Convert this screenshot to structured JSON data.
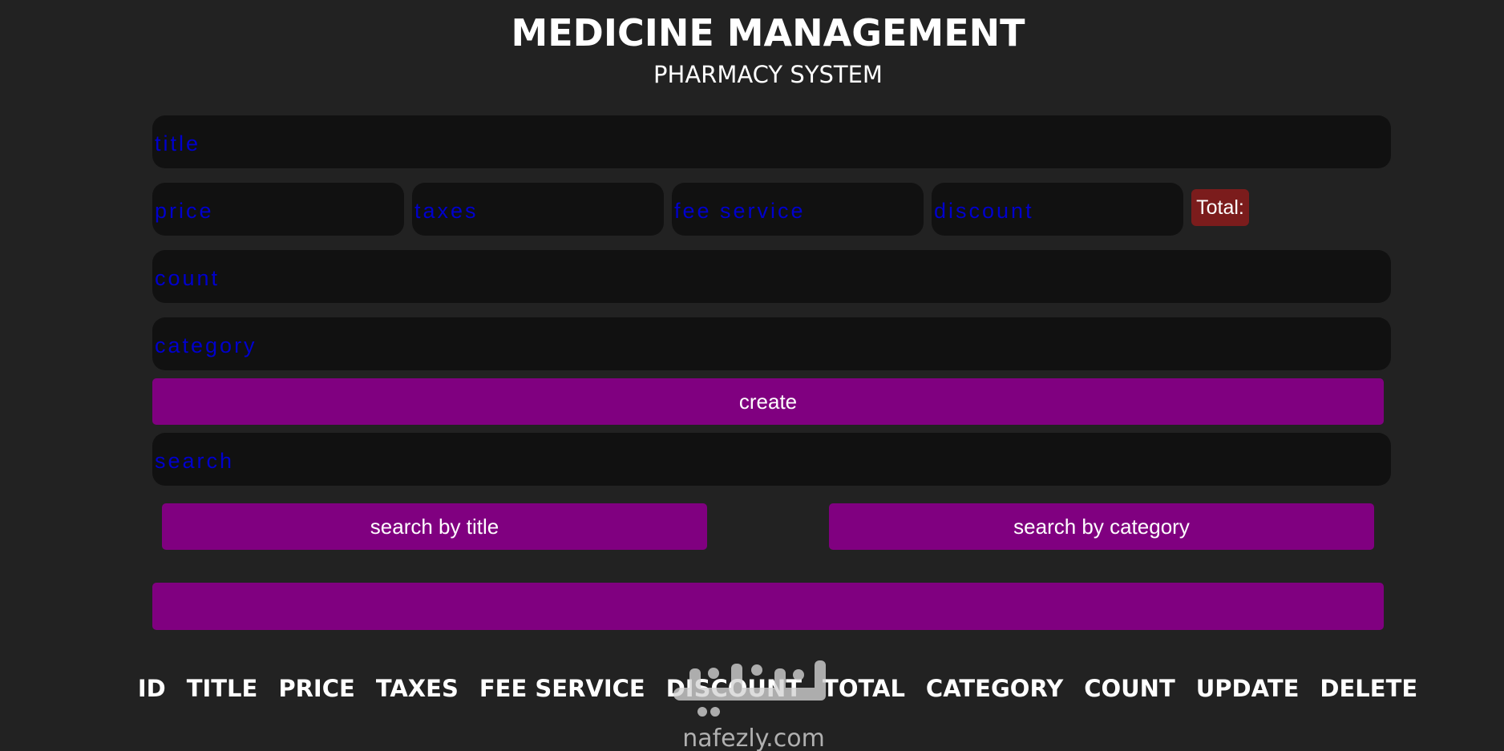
{
  "header": {
    "title": "MEDICINE MANAGEMENT",
    "subtitle": "PHARMACY SYSTEM"
  },
  "form": {
    "title_placeholder": "title",
    "price_placeholder": "price",
    "taxes_placeholder": "taxes",
    "fee_service_placeholder": "fee service",
    "discount_placeholder": "discount",
    "total_label": "Total:",
    "count_placeholder": "count",
    "category_placeholder": "category",
    "create_label": "create"
  },
  "search": {
    "placeholder": "search",
    "by_title_label": "search by title",
    "by_category_label": "search by category",
    "delete_all_label": ""
  },
  "table": {
    "columns": [
      "ID",
      "TITLE",
      "PRICE",
      "TAXES",
      "FEE SERVICE",
      "DISCOUNT",
      "TOTAL",
      "CATEGORY",
      "COUNT",
      "UPDATE",
      "DELETE"
    ]
  },
  "watermark": {
    "text": "nafezly.com",
    "logo_text": "نفذلي"
  },
  "colors": {
    "background": "#222222",
    "input_background": "#111111",
    "placeholder": "#0000cd",
    "button": "#800080",
    "total_badge": "#7b1c1c",
    "text": "#ffffff"
  }
}
